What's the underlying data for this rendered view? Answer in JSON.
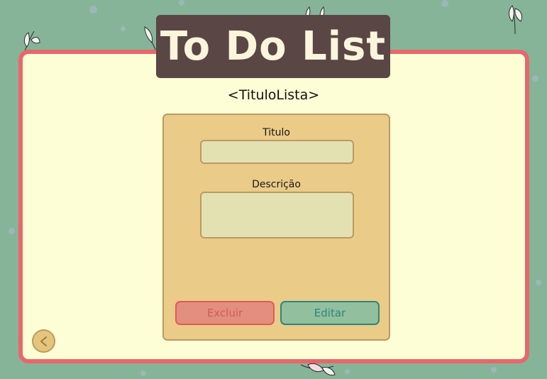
{
  "colors": {
    "background": "#86b498",
    "frame_border": "#e8676a",
    "frame_fill": "#fdfdd6",
    "banner": "#5b4646",
    "card": "#ebcb88",
    "delete": "#e28f80",
    "edit": "#92bf9d"
  },
  "header": {
    "app_title": "To Do List"
  },
  "list": {
    "title": "<TituloLista>"
  },
  "form": {
    "title_label": "Titulo",
    "title_value": "",
    "description_label": "Descrição",
    "description_value": ""
  },
  "actions": {
    "delete_label": "Excluir",
    "edit_label": "Editar"
  },
  "navigation": {
    "back_icon": "chevron-left-icon"
  }
}
